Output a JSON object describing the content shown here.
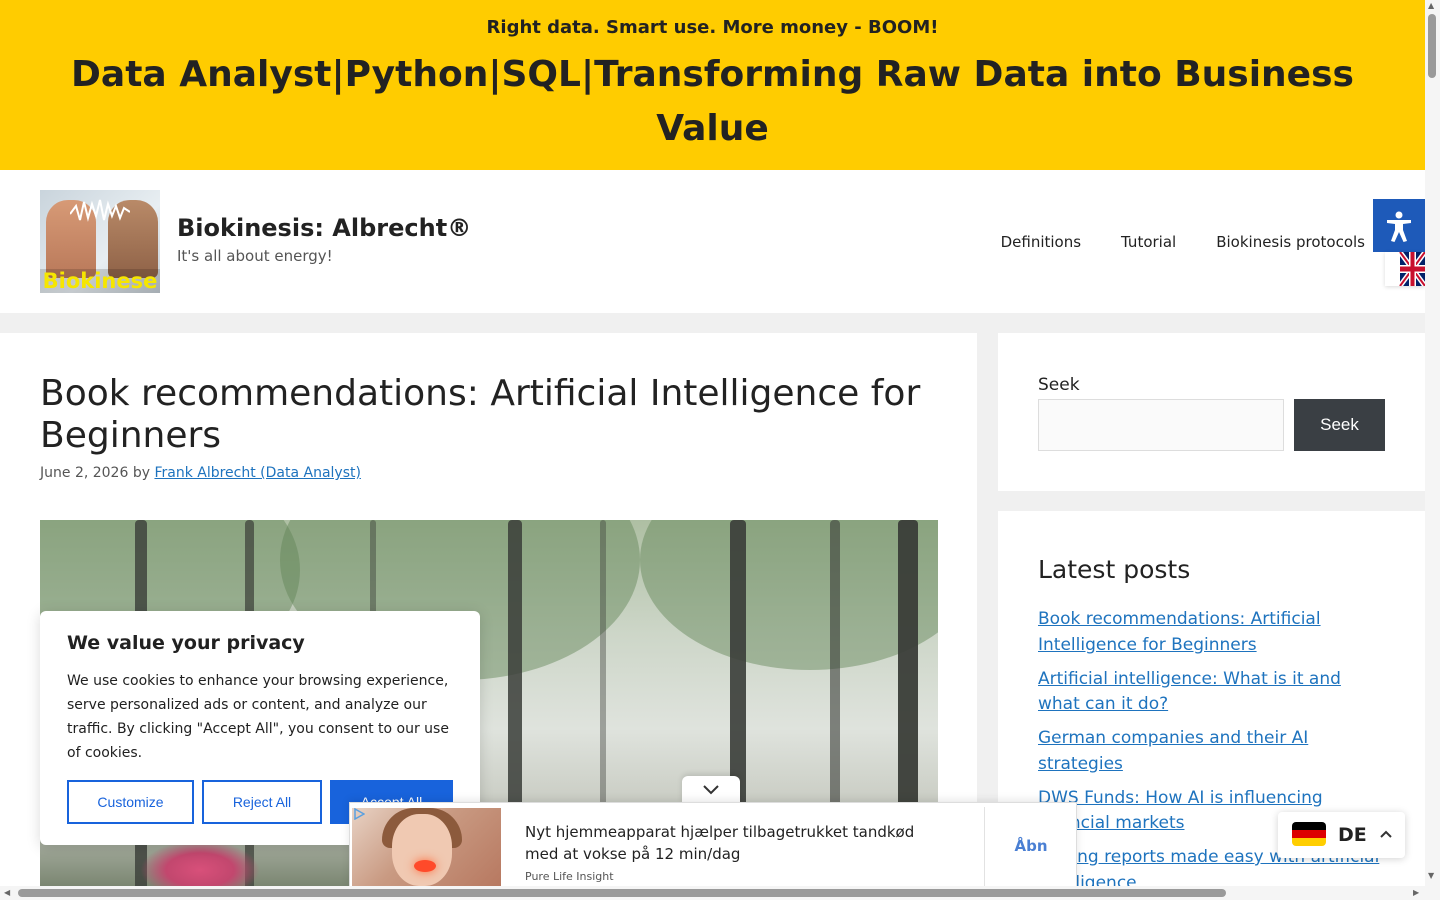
{
  "banner": {
    "tagline": "Right data. Smart use. More money - BOOM!",
    "headline": "Data Analyst|Python|SQL|Transforming Raw Data into Business Value"
  },
  "header": {
    "logo_text": "Biokinese",
    "site_title": "Biokinesis: Albrecht®",
    "site_description": "It's all about energy!",
    "nav": [
      "Definitions",
      "Tutorial",
      "Biokinesis protocols"
    ]
  },
  "post": {
    "title": "Book recommendations: Artificial Intelligence for Beginners",
    "date": "June 2, 2026",
    "by": "by",
    "author": "Frank Albrecht (Data Analyst)"
  },
  "sidebar": {
    "search_label": "Seek",
    "search_button": "Seek",
    "latest_title": "Latest posts",
    "latest_posts": [
      "Book recommendations: Artificial Intelligence for Beginners",
      "Artificial intelligence: What is it and what can it do?",
      "German companies and their AI strategies",
      "DWS Funds: How AI is influencing financial markets",
      "Writing reports made easy with artificial intelligence"
    ]
  },
  "cookie": {
    "title": "We value your privacy",
    "text": "We use cookies to enhance your browsing experience, serve personalized ads or content, and analyze our traffic. By clicking \"Accept All\", you consent to our use of cookies.",
    "customize": "Customize",
    "reject": "Reject All",
    "accept": "Accept All"
  },
  "ad": {
    "text": "Nyt hjemmeapparat hjælper tilbagetrukket tandkød med at vokse på 12 min/dag",
    "source": "Pure Life Insight",
    "cta": "Åbn"
  },
  "language": {
    "code": "DE"
  },
  "colors": {
    "banner_bg": "#ffcc00",
    "link": "#1e73be",
    "cookie_accent": "#1863dc",
    "search_button_bg": "#3a3f44",
    "a11y_blue": "#1e5ab9"
  },
  "icons": [
    "accessibility-icon",
    "uk-flag-icon",
    "de-flag-icon",
    "chevron-up-icon",
    "chevron-down-icon",
    "adchoices-icon"
  ]
}
